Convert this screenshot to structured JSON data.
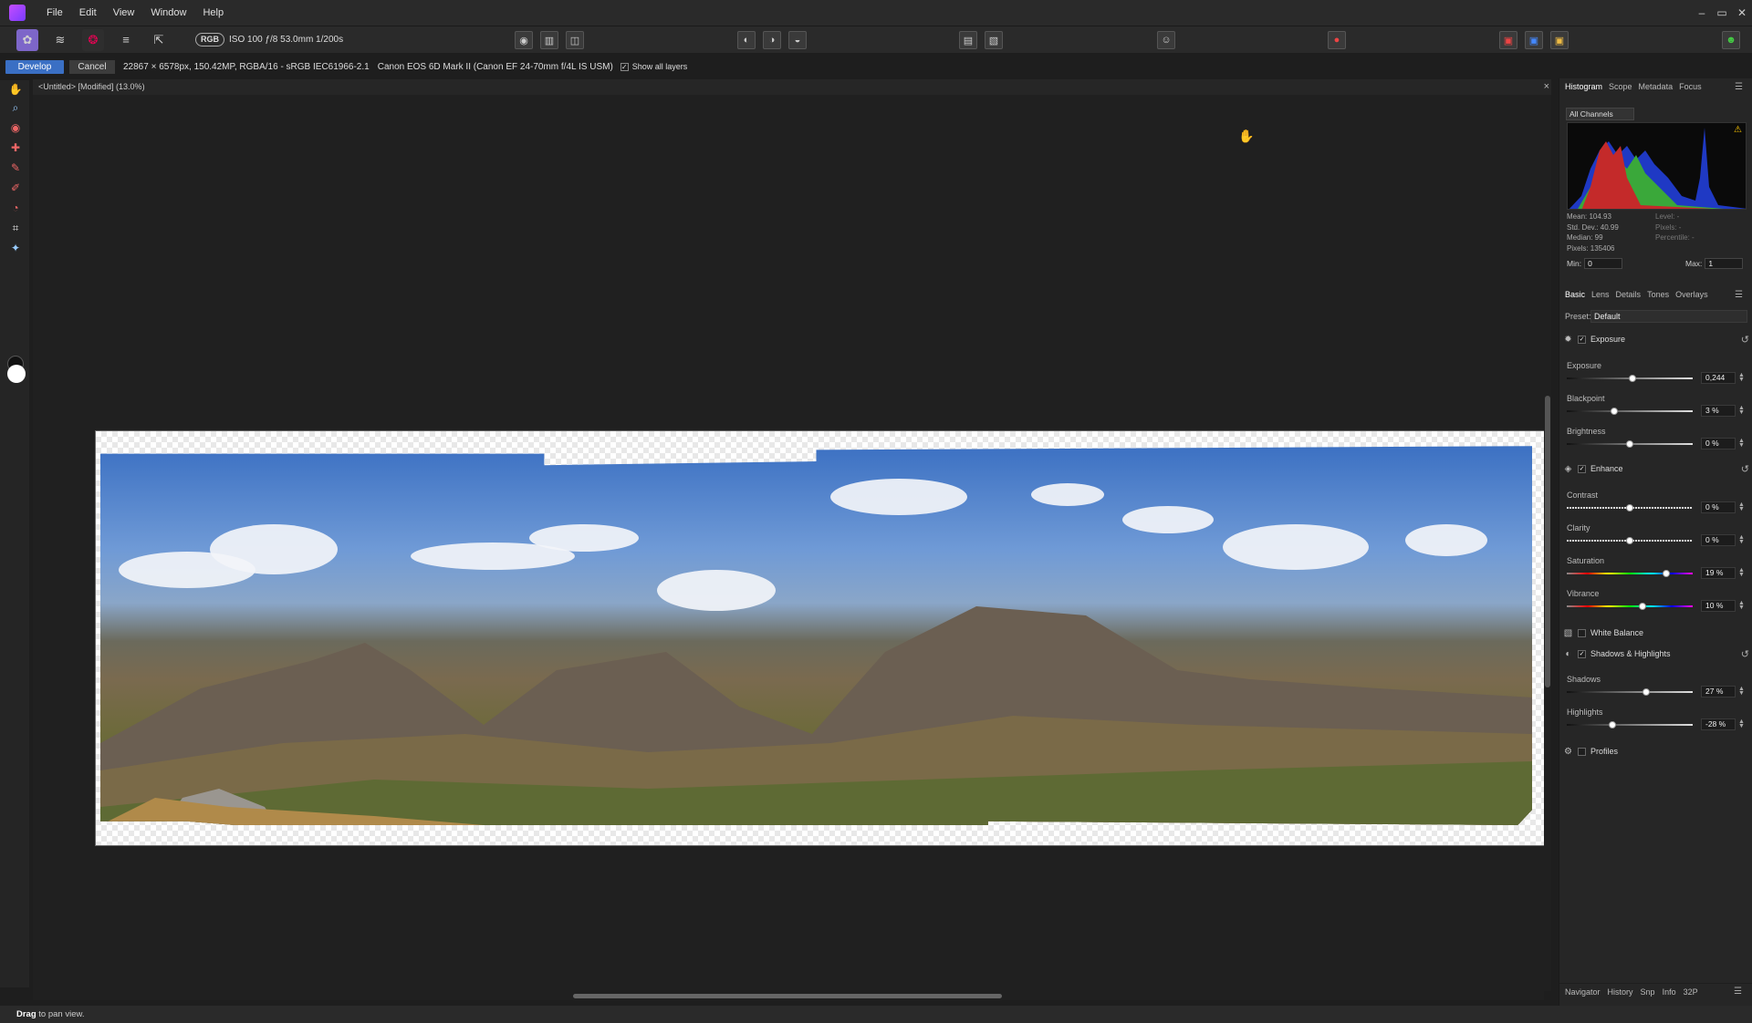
{
  "menu": {
    "file": "File",
    "edit": "Edit",
    "view": "View",
    "window": "Window",
    "help": "Help"
  },
  "window_controls": {
    "minimize": "–",
    "maximize": "▭",
    "close": "✕"
  },
  "toolbar": {
    "rgb": "RGB",
    "camera_info": "ISO 100 ƒ/8 53.0mm 1/200s"
  },
  "context": {
    "develop": "Develop",
    "cancel": "Cancel",
    "image_info": "22867 × 6578px, 150.42MP, RGBA/16 - sRGB IEC61966-2.1",
    "camera": "Canon EOS 6D Mark II (Canon EF 24-70mm f/4L IS USM)",
    "show_layers": "Show all layers",
    "show_layers_checked": true
  },
  "document": {
    "title": "<Untitled> [Modified] (13.0%)",
    "close": "×"
  },
  "status": {
    "action": "Drag",
    "rest": " to pan view."
  },
  "right_panel": {
    "top_tabs": [
      "Histogram",
      "Scope",
      "Metadata",
      "Focus"
    ],
    "channel": "All Channels",
    "stats_left": [
      "Mean: 104.93",
      "Std. Dev.: 40.99",
      "Median: 99",
      "Pixels: 135406"
    ],
    "stats_right": [
      "Level: -",
      "Pixels: -",
      "Percentile: -"
    ],
    "min_label": "Min:",
    "min_value": "0",
    "max_label": "Max:",
    "max_value": "1",
    "dev_tabs": [
      "Basic",
      "Lens",
      "Details",
      "Tones",
      "Overlays"
    ],
    "preset_label": "Preset:",
    "preset_value": "Default",
    "sections": {
      "exposure": "Exposure",
      "enhance": "Enhance",
      "white_balance": "White Balance",
      "shadows_highlights": "Shadows & Highlights",
      "profiles": "Profiles"
    },
    "sliders": {
      "exposure": {
        "label": "Exposure",
        "value": "0,244",
        "pos": 0.52
      },
      "blackpoint": {
        "label": "Blackpoint",
        "value": "3 %",
        "pos": 0.38
      },
      "brightness": {
        "label": "Brightness",
        "value": "0 %",
        "pos": 0.5
      },
      "contrast": {
        "label": "Contrast",
        "value": "0 %",
        "pos": 0.5
      },
      "clarity": {
        "label": "Clarity",
        "value": "0 %",
        "pos": 0.5
      },
      "saturation": {
        "label": "Saturation",
        "value": "19 %",
        "pos": 0.79
      },
      "vibrance": {
        "label": "Vibrance",
        "value": "10 %",
        "pos": 0.6
      },
      "shadows": {
        "label": "Shadows",
        "value": "27 %",
        "pos": 0.63
      },
      "highlights": {
        "label": "Highlights",
        "value": "-28 %",
        "pos": 0.36
      }
    },
    "bottom_tabs": [
      "Navigator",
      "History",
      "Snp",
      "Info",
      "32P"
    ]
  }
}
